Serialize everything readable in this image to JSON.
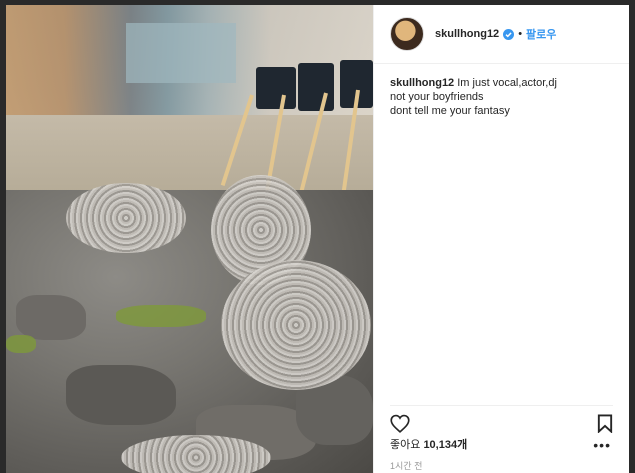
{
  "header": {
    "username": "skullhong12",
    "follow_label": "팔로우",
    "separator": "•"
  },
  "caption": {
    "username": "skullhong12",
    "lines": [
      "Im just vocal,actor,dj",
      "not your boyfriends",
      "dont tell me your fantasy"
    ]
  },
  "actions": {
    "like_icon": "heart-icon",
    "save_icon": "bookmark-icon",
    "more_icon": "more-options-icon"
  },
  "likes": {
    "label": "좋아요",
    "count": "10,134개"
  },
  "timestamp": "1시간 전",
  "colors": {
    "accent": "#3897f0",
    "text": "#262626",
    "muted": "#999999"
  }
}
